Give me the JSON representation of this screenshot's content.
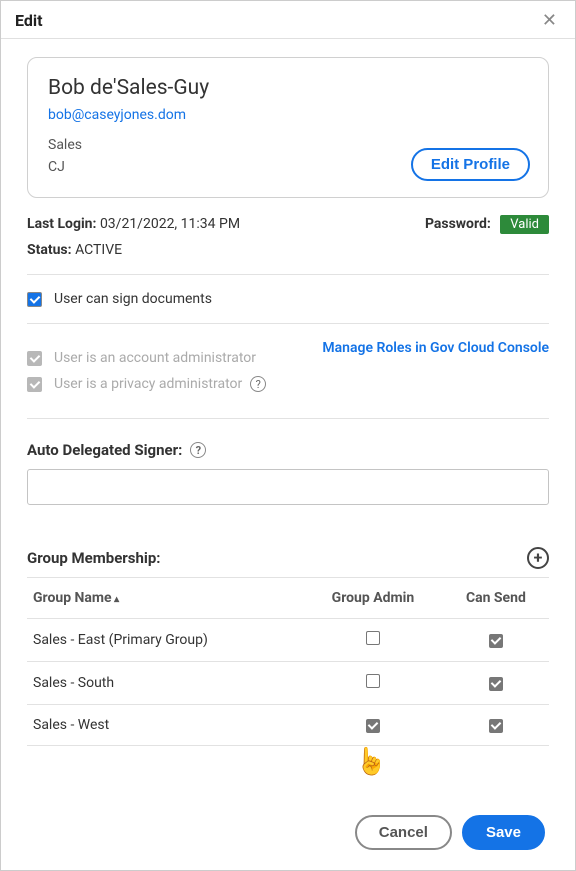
{
  "dialog": {
    "title": "Edit",
    "close_label": "✕"
  },
  "profile": {
    "name": "Bob de'Sales-Guy",
    "email": "bob@caseyjones.dom",
    "dept": "Sales",
    "initials": "CJ",
    "edit_btn": "Edit Profile"
  },
  "meta": {
    "last_login_label": "Last Login:",
    "last_login_value": "03/21/2022, 11:34 PM",
    "password_label": "Password:",
    "password_badge": "Valid",
    "status_label": "Status:",
    "status_value": "ACTIVE"
  },
  "checks": {
    "can_sign": "User can sign documents",
    "acct_admin": "User is an account administrator",
    "priv_admin": "User is a privacy administrator",
    "manage_link": "Manage Roles in Gov Cloud Console"
  },
  "auto_delegate": {
    "label": "Auto Delegated Signer:",
    "value": ""
  },
  "group_membership": {
    "heading": "Group Membership:",
    "col_name": "Group Name",
    "col_admin": "Group Admin",
    "col_send": "Can Send",
    "rows": [
      {
        "name": "Sales - East (Primary Group)",
        "admin": false,
        "send": true
      },
      {
        "name": "Sales - South",
        "admin": false,
        "send": true
      },
      {
        "name": "Sales - West",
        "admin": true,
        "send": true
      }
    ]
  },
  "footer": {
    "cancel": "Cancel",
    "save": "Save"
  }
}
